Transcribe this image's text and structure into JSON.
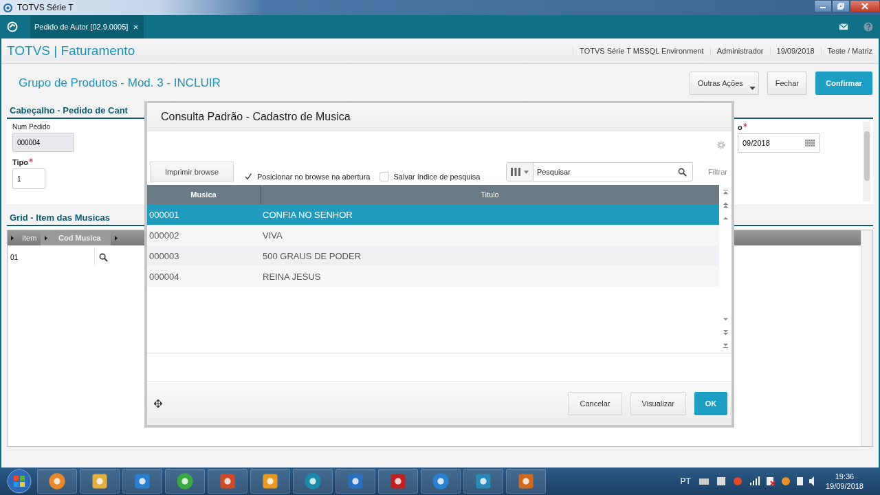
{
  "window": {
    "title": "TOTVS Série T"
  },
  "app_tabs": [
    {
      "label": "Pedido de Autor [02.9.0005]",
      "selected": true
    }
  ],
  "header": {
    "module": "TOTVS | Faturamento",
    "info": [
      "TOTVS Série T  MSSQL Environment",
      "Administrador",
      "19/09/2018",
      "Teste / Matriz"
    ]
  },
  "page": {
    "title": "Grupo de Produtos - Mod. 3 - INCLUIR",
    "actions": [
      {
        "label": "Outras Ações",
        "kind": "dropdown"
      },
      {
        "label": "Fechar",
        "kind": "default"
      },
      {
        "label": "Confirmar",
        "kind": "primary"
      }
    ]
  },
  "header_section": {
    "title": "Cabeçalho - Pedido de Cant",
    "fields": [
      {
        "label": "Num Pedido",
        "value": "000004",
        "required": false,
        "disabled": true
      },
      {
        "label": "Tipo",
        "value": "1",
        "required": true,
        "disabled": false
      }
    ],
    "right_fields": [
      {
        "label": "o",
        "value": "09/2018",
        "required": true,
        "kind": "date"
      }
    ]
  },
  "grid_section": {
    "title": "Grid - Item das Musicas",
    "columns": [
      "Item",
      "Cod Musica"
    ],
    "rows": [
      {
        "item": "01"
      }
    ]
  },
  "dialog": {
    "title": "Consulta Padrão - Cadastro de Musica",
    "print_button": "Imprimir browse",
    "options": [
      {
        "label": "Posicionar no browse na abertura",
        "checked": true
      },
      {
        "label": "Salvar índice de pesquisa",
        "checked": false
      }
    ],
    "search": {
      "placeholder": "Pesquisar"
    },
    "filter": "Filtrar",
    "columns": [
      "Musica",
      "Titulo"
    ],
    "rows": [
      {
        "cells": [
          "000001",
          "CONFIA NO SENHOR"
        ],
        "selected": true
      },
      {
        "cells": [
          "000002",
          "VIVA"
        ],
        "selected": false
      },
      {
        "cells": [
          "000003",
          "500 GRAUS DE PODER"
        ],
        "selected": false
      },
      {
        "cells": [
          "000004",
          "REINA JESUS"
        ],
        "selected": false
      }
    ],
    "buttons": [
      {
        "label": "Cancelar",
        "kind": "default"
      },
      {
        "label": "Visualizar",
        "kind": "default"
      },
      {
        "label": "OK",
        "kind": "primary"
      }
    ]
  },
  "taskbar": {
    "language": "PT",
    "time": "19:36",
    "date": "19/09/2018"
  }
}
